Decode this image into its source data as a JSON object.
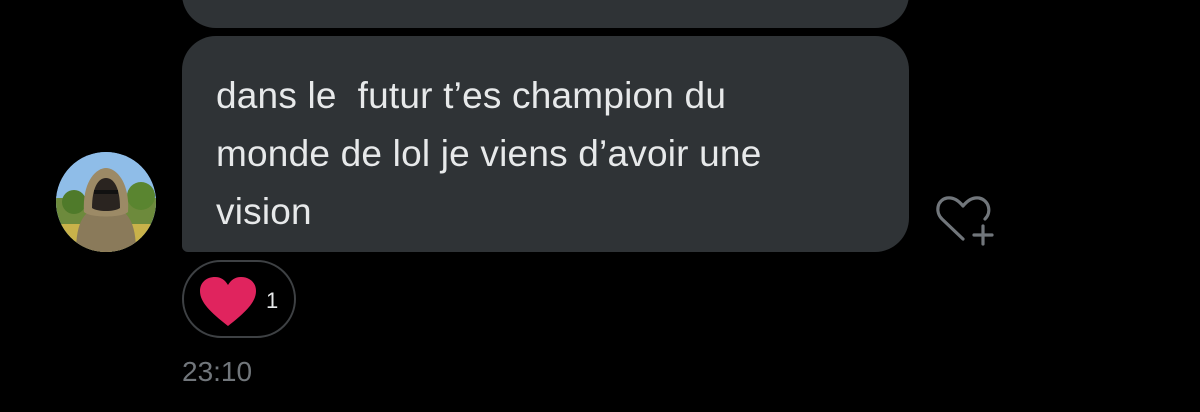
{
  "message": {
    "text": "dans le  futur t’es champion du\nmonde de lol je viens d’avoir une\nvision",
    "timestamp": "23:10"
  },
  "reactions": [
    {
      "icon": "red-heart-icon",
      "count": "1"
    }
  ],
  "actions": {
    "add_reaction_icon": "heart-plus-icon"
  },
  "colors": {
    "background": "#000000",
    "bubble": "#2f3336",
    "text": "#e7e9ea",
    "muted_text": "#71767b",
    "heart": "#e0245e"
  }
}
